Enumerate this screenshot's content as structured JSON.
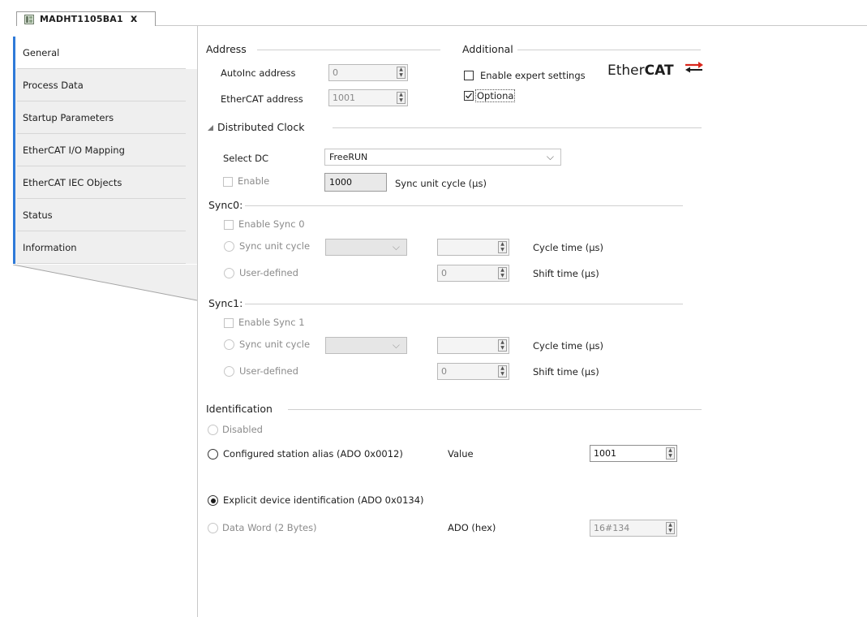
{
  "document_tab": {
    "title": "MADHT1105BA1",
    "close": "x"
  },
  "nav": {
    "items": [
      {
        "label": "General",
        "active": true
      },
      {
        "label": "Process Data",
        "active": false
      },
      {
        "label": "Startup Parameters",
        "active": false
      },
      {
        "label": "EtherCAT I/O Mapping",
        "active": false
      },
      {
        "label": "EtherCAT IEC Objects",
        "active": false
      },
      {
        "label": "Status",
        "active": false
      },
      {
        "label": "Information",
        "active": false
      }
    ],
    "accent_color": "#2f7ad8"
  },
  "address": {
    "title": "Address",
    "autoinc_label": "AutoInc address",
    "autoinc_value": "0",
    "ethercat_label": "EtherCAT address",
    "ethercat_value": "1001"
  },
  "additional": {
    "title": "Additional",
    "expert_label": "Enable expert settings",
    "expert_checked": false,
    "optional_label": "Optiona",
    "optional_checked": true
  },
  "logo": {
    "text_regular": "Ether",
    "text_bold": "CAT",
    "color": "#1c1c1c",
    "arrow_color": "#d9261c"
  },
  "distributed_clock": {
    "title": "Distributed Clock",
    "select_dc_label": "Select DC",
    "select_dc_value": "FreeRUN",
    "enable_label": "Enable",
    "enable_checked": false,
    "cycle_value": "1000",
    "cycle_label": "Sync unit cycle (µs)"
  },
  "sync0": {
    "title": "Sync0:",
    "enable_label": "Enable Sync 0",
    "sync_unit_cycle_label": "Sync unit cycle",
    "user_defined_label": "User-defined",
    "cycle_time_label": "Cycle time (µs)",
    "shift_time_label": "Shift time (µs)",
    "cycle_time_value": "",
    "shift_time_value": "0"
  },
  "sync1": {
    "title": "Sync1:",
    "enable_label": "Enable Sync 1",
    "sync_unit_cycle_label": "Sync unit cycle",
    "user_defined_label": "User-defined",
    "cycle_time_label": "Cycle time (µs)",
    "shift_time_label": "Shift time (µs)",
    "cycle_time_value": "",
    "shift_time_value": "0"
  },
  "identification": {
    "title": "Identification",
    "disabled_label": "Disabled",
    "configured_alias_label": "Configured station alias (ADO 0x0012)",
    "value_label": "Value",
    "value": "1001",
    "explicit_label": "Explicit device identification (ADO 0x0134)",
    "data_word_label": "Data Word (2 Bytes)",
    "ado_label": "ADO (hex)",
    "ado_value": "16#134",
    "selected": "explicit"
  }
}
